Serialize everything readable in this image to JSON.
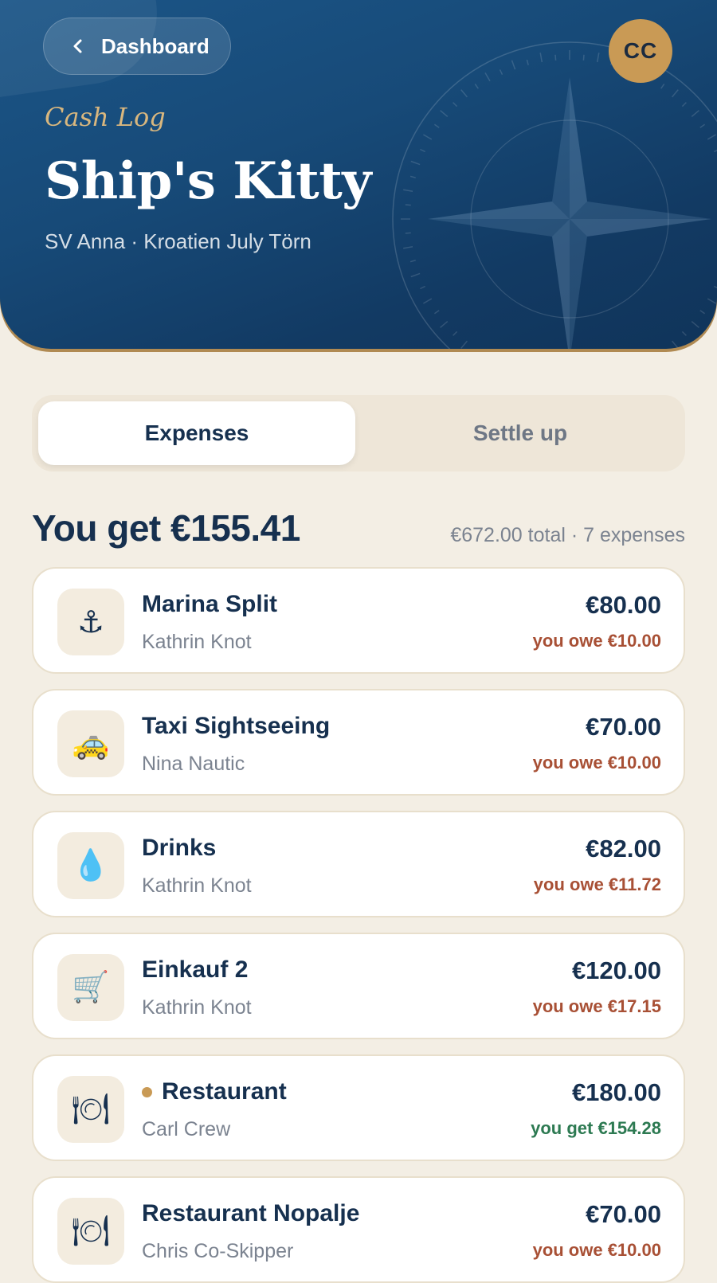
{
  "header": {
    "back_label": "Dashboard",
    "avatar_initials": "CC",
    "kicker": "Cash Log",
    "title": "Ship's Kitty",
    "subtitle": "SV Anna · Kroatien July Törn"
  },
  "tabs": [
    {
      "label": "Expenses",
      "active": true
    },
    {
      "label": "Settle up",
      "active": false
    }
  ],
  "summary": {
    "balance": "You get €155.41",
    "meta": "€672.00 total · 7 expenses"
  },
  "expenses": [
    {
      "icon": "anchor-icon",
      "glyph": "⚓",
      "name": "Marina Split",
      "payer": "Kathrin Knot",
      "amount": "€80.00",
      "share": "you owe €10.00",
      "share_type": "owe",
      "marked": false
    },
    {
      "icon": "taxi-icon",
      "glyph": "🚕",
      "name": "Taxi Sightseeing",
      "payer": "Nina Nautic",
      "amount": "€70.00",
      "share": "you owe €10.00",
      "share_type": "owe",
      "marked": false
    },
    {
      "icon": "droplet-icon",
      "glyph": "💧",
      "name": "Drinks",
      "payer": "Kathrin Knot",
      "amount": "€82.00",
      "share": "you owe €11.72",
      "share_type": "owe",
      "marked": false
    },
    {
      "icon": "shopping-cart-icon",
      "glyph": "🛒",
      "name": "Einkauf 2",
      "payer": "Kathrin Knot",
      "amount": "€120.00",
      "share": "you owe €17.15",
      "share_type": "owe",
      "marked": false
    },
    {
      "icon": "plate-cutlery-icon",
      "glyph": "🍽",
      "name": "Restaurant",
      "payer": "Carl Crew",
      "amount": "€180.00",
      "share": "you get €154.28",
      "share_type": "get",
      "marked": true
    },
    {
      "icon": "plate-cutlery-icon",
      "glyph": "🍽",
      "name": "Restaurant Nopalje",
      "payer": "Chris Co-Skipper",
      "amount": "€70.00",
      "share": "you owe €10.00",
      "share_type": "owe",
      "marked": false
    }
  ],
  "colors": {
    "header_blue": "#174a78",
    "gold": "#c99a55",
    "owe": "#a85035",
    "get": "#2d7a52",
    "background": "#f3eee4"
  }
}
